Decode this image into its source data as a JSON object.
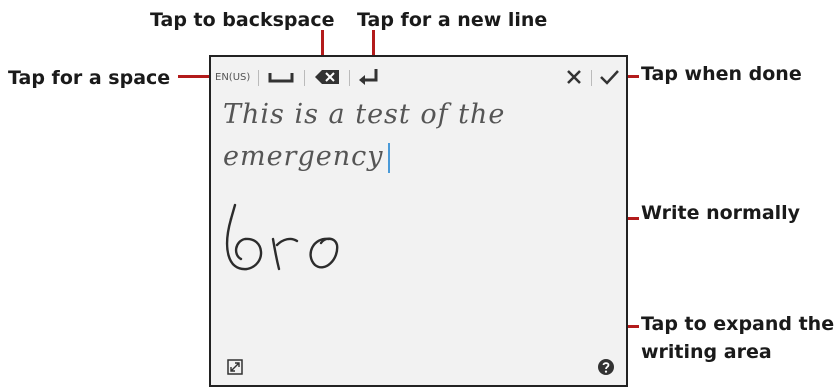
{
  "callouts": {
    "backspace": "Tap to backspace",
    "new_line": "Tap for a new line",
    "space": "Tap for a space",
    "done": "Tap when done",
    "write": "Write normally",
    "expand_line1": "Tap to expand the",
    "expand_line2": "writing area"
  },
  "panel": {
    "language": "EN(US)",
    "recognized_line1": "This is a test of the",
    "recognized_line2": "emergency",
    "ink_text": "bro"
  },
  "colors": {
    "callout_line": "#b31b1b",
    "caret": "#4a9ad8",
    "panel_bg": "#f2f2f2"
  },
  "icons": [
    "space-key-icon",
    "backspace-icon",
    "enter-icon",
    "close-icon",
    "checkmark-icon",
    "expand-icon",
    "help-icon"
  ]
}
